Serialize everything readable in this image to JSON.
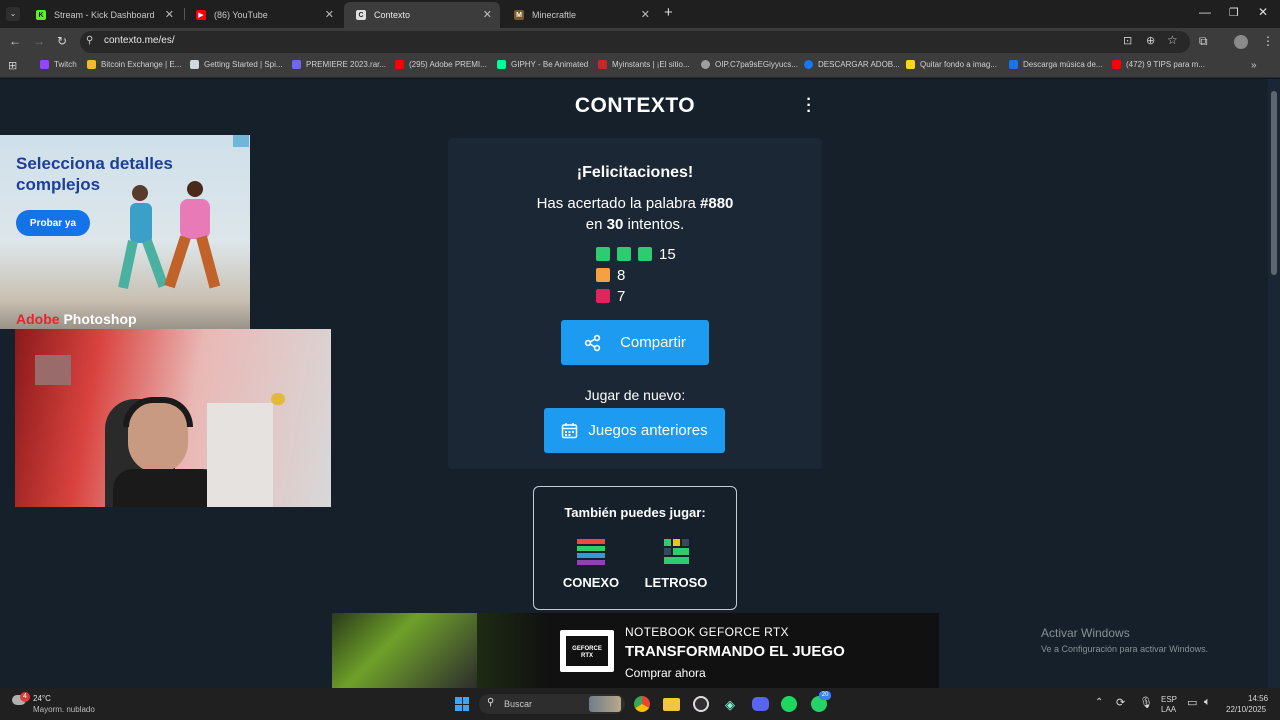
{
  "browser": {
    "tabs": [
      {
        "label": "Stream - Kick Dashboard",
        "fav_color": "#53fc18",
        "fav_text": "K"
      },
      {
        "label": "(86) YouTube",
        "fav_color": "#ff0000",
        "fav_text": "▶"
      },
      {
        "label": "Contexto",
        "fav_color": "#e0e0e0",
        "fav_text": "C"
      },
      {
        "label": "Minecraftle",
        "fav_color": "#7a5a2a",
        "fav_text": "M"
      }
    ],
    "url": "contexto.me/es/",
    "bookmarks": [
      {
        "label": "Twitch",
        "color": "#9146ff"
      },
      {
        "label": "Bitcoin Exchange | E...",
        "color": "#f3ba2f"
      },
      {
        "label": "Getting Started | Spi...",
        "color": "#cfd8dc"
      },
      {
        "label": "PREMIERE 2023.rar...",
        "color": "#6e6adf"
      },
      {
        "label": "(295) Adobe PREMI...",
        "color": "#ff0000"
      },
      {
        "label": "GIPHY - Be Animated",
        "color": "#00ff99"
      },
      {
        "label": "Myinstants | ¡El sitio...",
        "color": "#c62828"
      },
      {
        "label": "OIP.C7pa9sEGiyyucs...",
        "color": "#9e9e9e"
      },
      {
        "label": "DESCARGAR ADOB...",
        "color": "#1877f2"
      },
      {
        "label": "Quitar fondo a imag...",
        "color": "#f9d71c"
      },
      {
        "label": "Descarga música de...",
        "color": "#1a73e8"
      },
      {
        "label": "(472) 9 TIPS para m...",
        "color": "#ff0000"
      }
    ]
  },
  "page": {
    "logo": "CONTEXTO",
    "congrats": "¡Felicitaciones!",
    "result_prefix": "Has acertado la palabra ",
    "word_number": "#880",
    "attempts_prefix": "en ",
    "attempts": "30",
    "attempts_suffix": " intentos.",
    "stats": [
      {
        "squares": 3,
        "color": "#2ecc71",
        "count": "15"
      },
      {
        "squares": 1,
        "color": "#f5a142",
        "count": "8"
      },
      {
        "squares": 1,
        "color": "#e0245e",
        "count": "7"
      }
    ],
    "share_label": "Compartir",
    "play_again": "Jugar de nuevo:",
    "history_label": "Juegos anteriores",
    "also_play": "También puedes jugar:",
    "games": [
      {
        "name": "CONEXO"
      },
      {
        "name": "LETROSO"
      }
    ],
    "accent": "#1d9bf0"
  },
  "ads": {
    "photoshop": {
      "title": "Selecciona detalles complejos",
      "button": "Probar ya",
      "brand_a": "Adobe",
      "brand_b": " Photoshop"
    },
    "nvidia": {
      "line1": "NOTEBOOK GEFORCE RTX",
      "line2": "TRANSFORMANDO EL JUEGO",
      "line3": "Comprar ahora",
      "logo_text": "GEFORCE RTX"
    }
  },
  "windows": {
    "activate_title": "Activar Windows",
    "activate_sub": "Ve a Configuración para activar Windows."
  },
  "taskbar": {
    "weather_temp": "24°C",
    "weather_desc": "Mayorm. nublado",
    "weather_badge": "4",
    "search_placeholder": "Buscar",
    "lang1": "ESP",
    "lang2": "LAA",
    "time": "14:56",
    "date": "22/10/2025",
    "whatsapp_badge": "20"
  }
}
